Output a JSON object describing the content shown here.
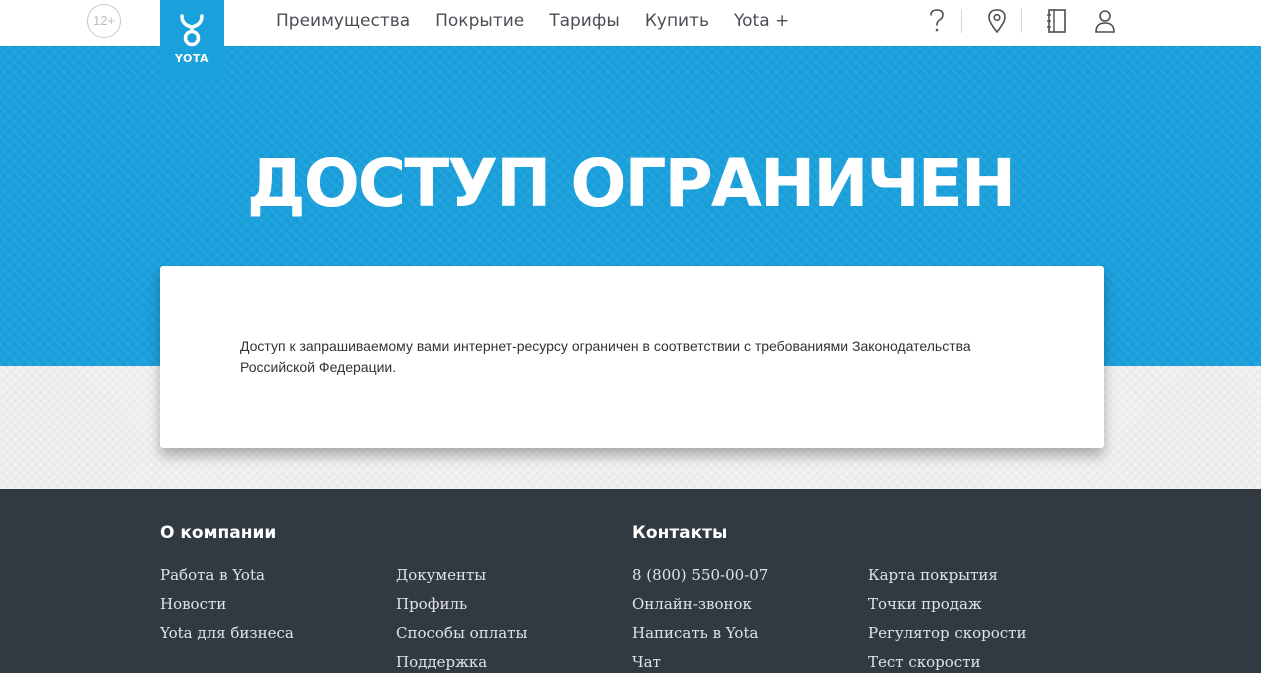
{
  "header": {
    "age_rating": "12+",
    "logo_text": "YOTA",
    "nav": [
      {
        "label": "Преимущества"
      },
      {
        "label": "Покрытие"
      },
      {
        "label": "Тарифы"
      },
      {
        "label": "Купить"
      },
      {
        "label": "Yota +"
      }
    ],
    "tools": [
      "help-icon",
      "location-pin-icon",
      "notebook-icon",
      "user-icon"
    ]
  },
  "hero": {
    "title": "ДОСТУП ОГРАНИЧЕН"
  },
  "notice": {
    "text": "Доступ к запрашиваемому вами интернет-ресурсу ограничен в соответствии с требованиями Законодательства Российской Федерации."
  },
  "footer": {
    "company_heading": "О компании",
    "contacts_heading": "Контакты",
    "col1": [
      {
        "label": "Работа в Yota"
      },
      {
        "label": "Новости"
      },
      {
        "label": "Yota для бизнеса"
      }
    ],
    "col2": [
      {
        "label": "Документы"
      },
      {
        "label": "Профиль"
      },
      {
        "label": "Способы оплаты"
      },
      {
        "label": "Поддержка"
      }
    ],
    "col3": [
      {
        "label": "8 (800) 550-00-07"
      },
      {
        "label": "Онлайн-звонок"
      },
      {
        "label": "Написать в Yota"
      },
      {
        "label": "Чат"
      }
    ],
    "col4": [
      {
        "label": "Карта покрытия"
      },
      {
        "label": "Точки продаж"
      },
      {
        "label": "Регулятор скорости"
      },
      {
        "label": "Тест скорости"
      }
    ]
  },
  "colors": {
    "brand_blue": "#1aa0dc",
    "footer_bg": "#323a41",
    "nav_text": "#4a4f55"
  }
}
